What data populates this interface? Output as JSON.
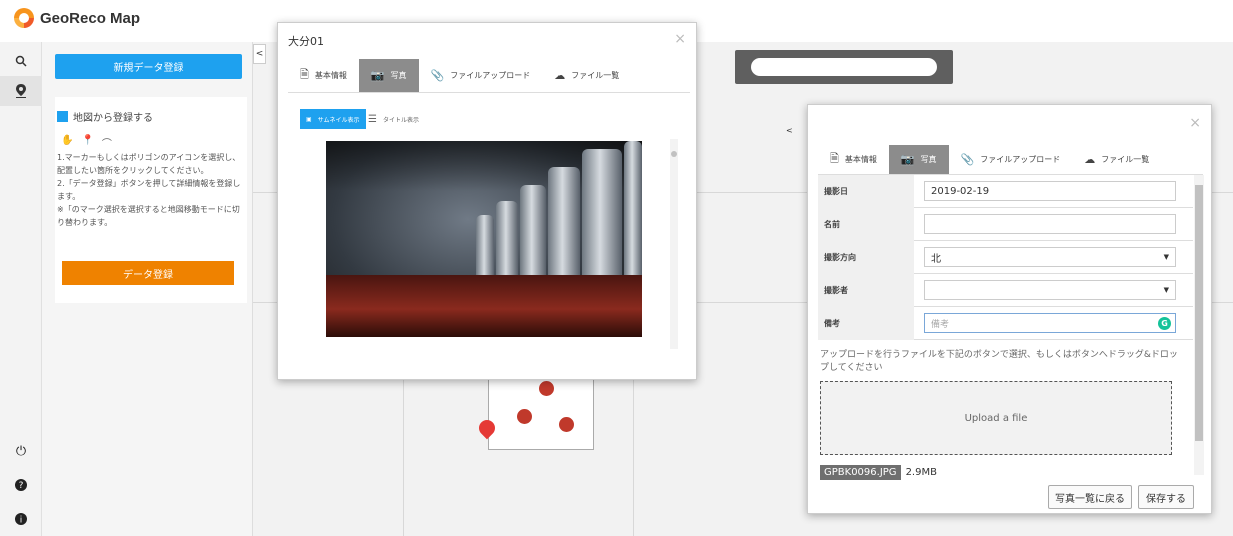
{
  "app": {
    "title": "GeoReco Map"
  },
  "sidebar": {
    "new_data_label": "新規データ登録",
    "register": {
      "checkbox_label": "地図から登録する",
      "tool_icons": [
        "hand-icon",
        "marker-icon",
        "polygon-icon"
      ],
      "instructions": [
        "1.マーカーもしくはポリゴンのアイコンを選択し、配置したい箇所をクリックしてください。",
        "2.「データ登録」ボタンを押して詳細情報を登録します。",
        "※「のマーク選択を選択すると地図移動モードに切り替わります。"
      ],
      "register_button_label": "データ登録"
    },
    "collapse_glyph": "<"
  },
  "icons": {
    "search": "search-icon",
    "marker": "marker-icon",
    "power": "power-icon",
    "help": "help-icon",
    "info": "info-icon"
  },
  "dialog1": {
    "title": "大分01",
    "close_glyph": "×",
    "tabs": [
      {
        "label": "基本情報",
        "icon": "document-icon",
        "active": false
      },
      {
        "label": "写真",
        "icon": "camera-icon",
        "active": true
      },
      {
        "label": "ファイルアップロード",
        "icon": "paperclip-icon",
        "active": false
      },
      {
        "label": "ファイル一覧",
        "icon": "cloud-icon",
        "active": false
      }
    ],
    "view_buttons": {
      "thumbnail": "サムネイル表示",
      "title": "タイトル表示"
    }
  },
  "dialog2": {
    "close_glyph": "×",
    "tabs": [
      {
        "label": "基本情報",
        "icon": "document-icon",
        "active": false
      },
      {
        "label": "写真",
        "icon": "camera-icon",
        "active": true
      },
      {
        "label": "ファイルアップロード",
        "icon": "paperclip-icon",
        "active": false
      },
      {
        "label": "ファイル一覧",
        "icon": "cloud-icon",
        "active": false
      }
    ],
    "fields": {
      "date": {
        "label": "撮影日",
        "value": "2019-02-19"
      },
      "name": {
        "label": "名前",
        "value": ""
      },
      "direction": {
        "label": "撮影方向",
        "value": "北"
      },
      "photographer": {
        "label": "撮影者",
        "value": ""
      },
      "remarks": {
        "label": "備考",
        "placeholder": "備考"
      }
    },
    "upload_note": "アップロードを行うファイルを下記のボタンで選択、もしくはボタンへドラッグ&ドロップしてください",
    "upload_label": "Upload a file",
    "file": {
      "name": "GPBK0096.JPG",
      "size": "2.9MB"
    },
    "back_button_label": "写真一覧に戻る",
    "save_button_label": "保存する"
  },
  "colors": {
    "primary": "#1ea1ef",
    "orange": "#ef8200",
    "active_tab": "#8c8c8c",
    "pin": "#e53935"
  }
}
